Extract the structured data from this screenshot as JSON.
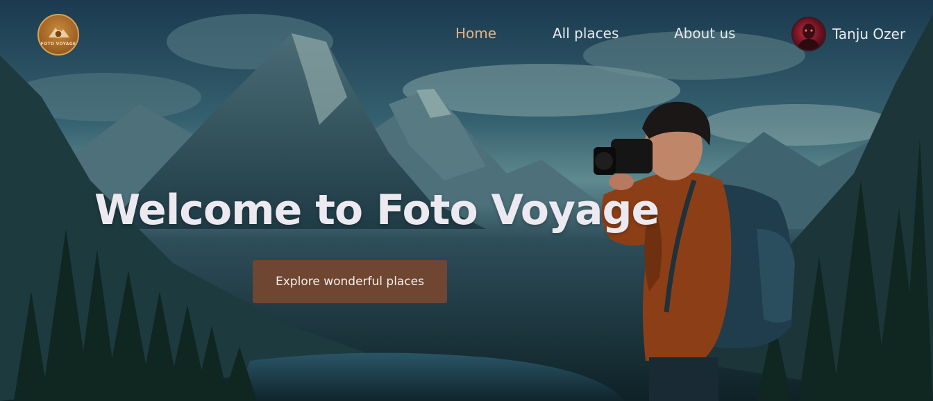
{
  "brand": {
    "logo_text": "FOTO VOYAGE",
    "accent_color": "#e5b483",
    "button_color": "#6e4632"
  },
  "nav": {
    "items": [
      {
        "label": "Home",
        "active": true
      },
      {
        "label": "All places",
        "active": false
      },
      {
        "label": "About us",
        "active": false
      }
    ]
  },
  "user": {
    "name": "Tanju Ozer",
    "avatar_icon": "user-avatar"
  },
  "hero": {
    "title": "Welcome to Foto Voyage",
    "cta_label": "Explore wonderful places"
  }
}
